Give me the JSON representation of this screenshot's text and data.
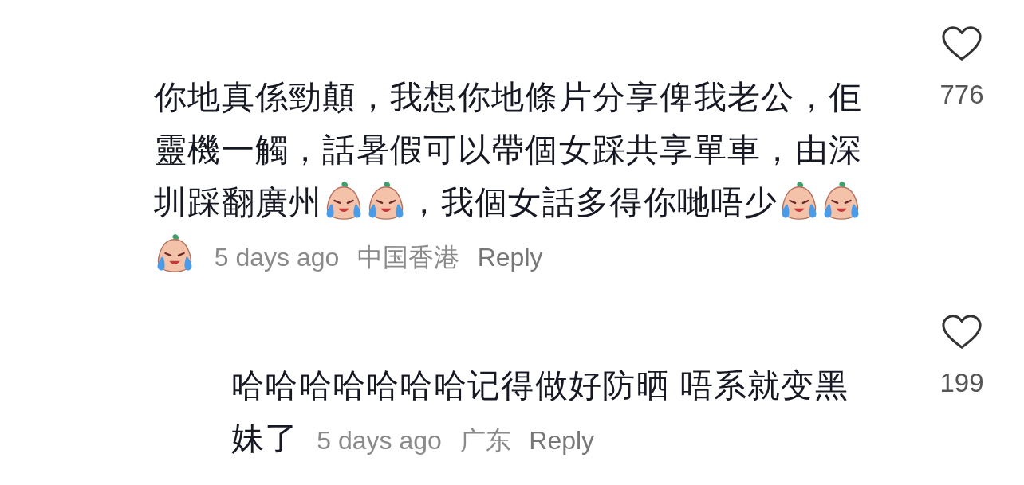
{
  "comments": [
    {
      "kind": "comment",
      "segments": [
        {
          "kind": "text",
          "text": "你地真係勁顛，我想你地條片分享俾我老公，佢"
        },
        {
          "kind": "text",
          "text": "靈機一觸，話暑假可以帶個女踩共享單車，由深"
        },
        {
          "kind": "text",
          "text": "圳踩翻廣州"
        },
        {
          "kind": "emoji"
        },
        {
          "kind": "emoji"
        },
        {
          "kind": "text",
          "text": "，我個女話多得你哋唔少"
        },
        {
          "kind": "emoji"
        },
        {
          "kind": "emoji"
        },
        {
          "kind": "emoji"
        }
      ],
      "age": "5 days ago",
      "location": "中国香港",
      "reply": "Reply",
      "likes": {
        "count": "776",
        "liked": false
      }
    },
    {
      "kind": "reply",
      "segments": [
        {
          "kind": "text",
          "text": "哈哈哈哈哈哈哈记得做好防晒 唔系就变黑"
        },
        {
          "kind": "text",
          "text": "妹了"
        }
      ],
      "age": "5 days ago",
      "location": "广东",
      "reply": "Reply",
      "likes": {
        "count": "199",
        "liked": false
      }
    }
  ]
}
